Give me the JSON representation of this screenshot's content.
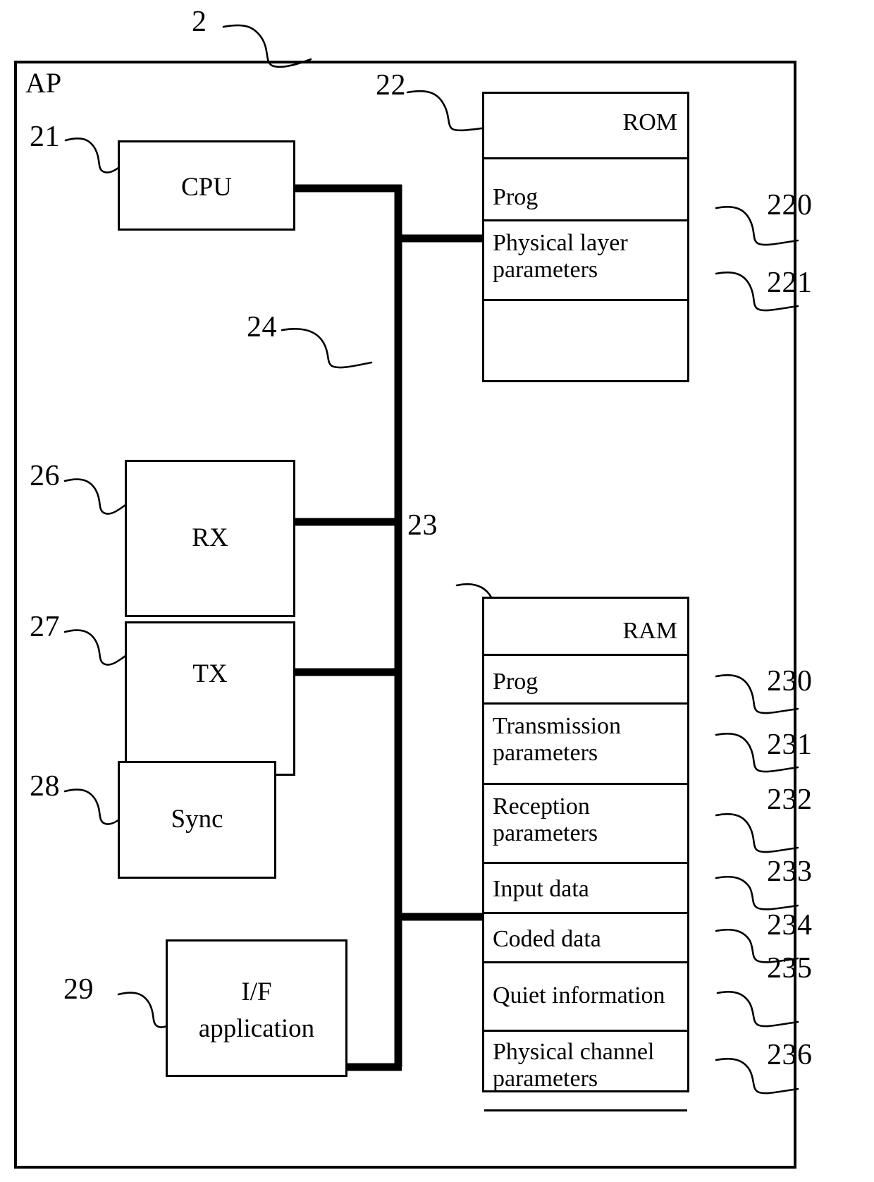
{
  "figure": {
    "device_label": "AP",
    "device_ref": "2"
  },
  "components": [
    {
      "ref": "21",
      "label": "CPU"
    },
    {
      "ref": "26",
      "label": "RX"
    },
    {
      "ref": "27",
      "label": "TX"
    },
    {
      "ref": "28",
      "label": "Sync"
    },
    {
      "ref": "29",
      "label_line1": "I/F",
      "label_line2": "application"
    }
  ],
  "bus": {
    "ref": "24"
  },
  "rom": {
    "ref": "22",
    "title": "ROM",
    "rows": [
      {
        "ref": "220",
        "label": "Prog"
      },
      {
        "ref": "221",
        "label": "Physical layer parameters"
      },
      {
        "ref": "",
        "label": ""
      }
    ]
  },
  "ram": {
    "ref": "23",
    "title": "RAM",
    "rows": [
      {
        "ref": "230",
        "label": "Prog"
      },
      {
        "ref": "231",
        "label": "Transmission parameters"
      },
      {
        "ref": "232",
        "label": "Reception parameters"
      },
      {
        "ref": "233",
        "label": "Input data"
      },
      {
        "ref": "234",
        "label": "Coded data"
      },
      {
        "ref": "235",
        "label": "Quiet information"
      },
      {
        "ref": "236",
        "label": "Physical channel parameters"
      },
      {
        "ref": "",
        "label": ""
      }
    ]
  },
  "colors": {
    "line": "#000000",
    "background": "#ffffff"
  }
}
